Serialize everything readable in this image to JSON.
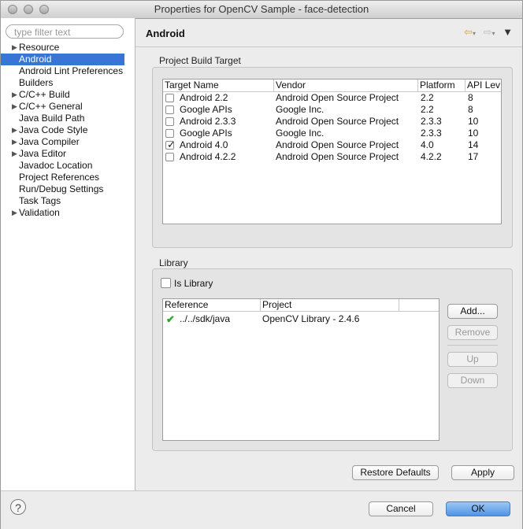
{
  "window": {
    "title": "Properties for OpenCV Sample - face-detection"
  },
  "sidebar": {
    "filter_placeholder": "type filter text",
    "items": [
      {
        "label": "Resource",
        "expandable": true
      },
      {
        "label": "Android",
        "expandable": false,
        "selected": true
      },
      {
        "label": "Android Lint Preferences",
        "expandable": false
      },
      {
        "label": "Builders",
        "expandable": false
      },
      {
        "label": "C/C++ Build",
        "expandable": true
      },
      {
        "label": "C/C++ General",
        "expandable": true
      },
      {
        "label": "Java Build Path",
        "expandable": false
      },
      {
        "label": "Java Code Style",
        "expandable": true
      },
      {
        "label": "Java Compiler",
        "expandable": true
      },
      {
        "label": "Java Editor",
        "expandable": true
      },
      {
        "label": "Javadoc Location",
        "expandable": false
      },
      {
        "label": "Project References",
        "expandable": false
      },
      {
        "label": "Run/Debug Settings",
        "expandable": false
      },
      {
        "label": "Task Tags",
        "expandable": false
      },
      {
        "label": "Validation",
        "expandable": true
      }
    ]
  },
  "header": {
    "title": "Android"
  },
  "build_target": {
    "label": "Project Build Target",
    "columns": [
      "Target Name",
      "Vendor",
      "Platform",
      "API Lev"
    ],
    "rows": [
      {
        "name": "Android 2.2",
        "vendor": "Android Open Source Project",
        "platform": "2.2",
        "api": "8",
        "checked": false
      },
      {
        "name": "Google APIs",
        "vendor": "Google Inc.",
        "platform": "2.2",
        "api": "8",
        "checked": false
      },
      {
        "name": "Android 2.3.3",
        "vendor": "Android Open Source Project",
        "platform": "2.3.3",
        "api": "10",
        "checked": false
      },
      {
        "name": "Google APIs",
        "vendor": "Google Inc.",
        "platform": "2.3.3",
        "api": "10",
        "checked": false
      },
      {
        "name": "Android 4.0",
        "vendor": "Android Open Source Project",
        "platform": "4.0",
        "api": "14",
        "checked": true
      },
      {
        "name": "Android 4.2.2",
        "vendor": "Android Open Source Project",
        "platform": "4.2.2",
        "api": "17",
        "checked": false
      }
    ]
  },
  "library": {
    "label": "Library",
    "is_library_label": "Is Library",
    "is_library_checked": false,
    "columns": [
      "Reference",
      "Project"
    ],
    "rows": [
      {
        "reference": "../../sdk/java",
        "project": "OpenCV Library - 2.4.6"
      }
    ],
    "buttons": {
      "add": "Add...",
      "remove": "Remove",
      "up": "Up",
      "down": "Down"
    }
  },
  "actions": {
    "restore_defaults": "Restore Defaults",
    "apply": "Apply"
  },
  "footer": {
    "cancel": "Cancel",
    "ok": "OK",
    "help": "?"
  },
  "icons": {
    "back": "back-arrow-icon",
    "forward": "forward-arrow-icon",
    "menu": "view-menu-icon",
    "valid": "green-check-icon"
  }
}
